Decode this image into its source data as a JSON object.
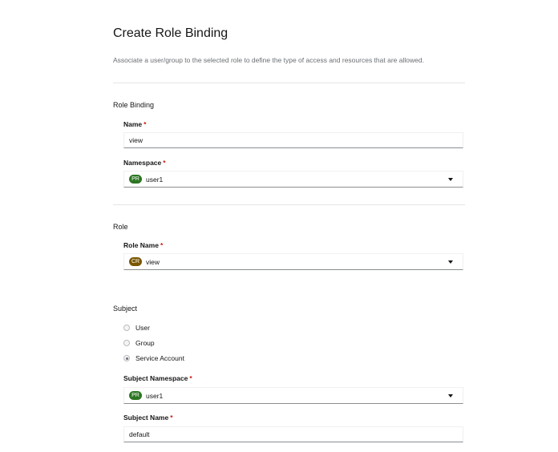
{
  "header": {
    "title": "Create Role Binding",
    "subtitle": "Associate a user/group to the selected role to define the type of access and resources that are allowed."
  },
  "role_binding": {
    "section_title": "Role Binding",
    "name_label": "Name",
    "name_value": "view",
    "namespace_label": "Namespace",
    "namespace_badge": "PR",
    "namespace_value": "user1"
  },
  "role": {
    "section_title": "Role",
    "role_name_label": "Role Name",
    "role_badge": "CR",
    "role_value": "view"
  },
  "subject": {
    "section_title": "Subject",
    "options": [
      {
        "label": "User",
        "checked": false
      },
      {
        "label": "Group",
        "checked": false
      },
      {
        "label": "Service Account",
        "checked": true
      }
    ],
    "subject_namespace_label": "Subject Namespace",
    "subject_namespace_badge": "PR",
    "subject_namespace_value": "user1",
    "subject_name_label": "Subject Name",
    "subject_name_value": "default"
  },
  "required_marker": "*",
  "colors": {
    "project_badge": "#2d7623",
    "cluster_role_badge": "#795600",
    "required": "#c9190b"
  }
}
